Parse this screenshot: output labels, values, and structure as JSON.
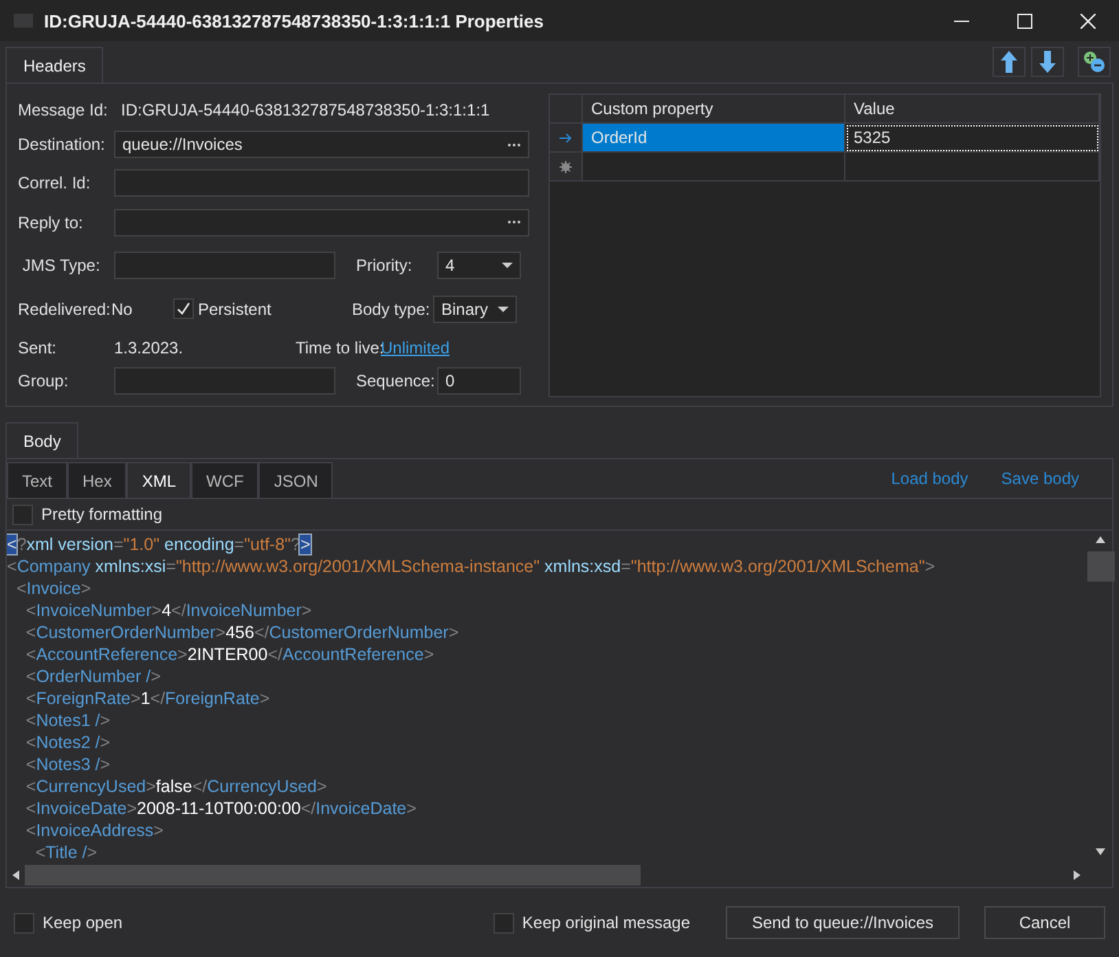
{
  "window": {
    "title": "ID:GRUJA-54440-638132787548738350-1:3:1:1:1 Properties"
  },
  "header_tab": {
    "label": "Headers",
    "selected": true
  },
  "headers": {
    "message_id": {
      "label": "Message Id:",
      "value": "ID:GRUJA-54440-638132787548738350-1:3:1:1:1"
    },
    "destination": {
      "label": "Destination:",
      "value": "queue://Invoices"
    },
    "correl_id": {
      "label": "Correl. Id:"
    },
    "reply_to": {
      "label": "Reply to:"
    },
    "jms_type": {
      "label": "JMS Type:"
    },
    "priority": {
      "label": "Priority:",
      "value": "4"
    },
    "redelivered": {
      "label": "Redelivered:",
      "value": "No"
    },
    "persistent": {
      "label": "Persistent",
      "checked": true
    },
    "body_type": {
      "label": "Body type:",
      "value": "Binary"
    },
    "sent": {
      "label": "Sent:",
      "value": "1.3.2023."
    },
    "time_to_live": {
      "label": "Time to live:",
      "value": "Unlimited"
    },
    "group": {
      "label": "Group:"
    },
    "sequence": {
      "label": "Sequence:",
      "value": "0"
    }
  },
  "properties": {
    "columns": [
      "Custom property",
      "Value"
    ],
    "rows": [
      {
        "name": "OrderId",
        "value": "5325",
        "selected": true
      }
    ]
  },
  "body_tab": {
    "label": "Body",
    "selected": true
  },
  "format_tabs": [
    {
      "label": "Text",
      "selected": false
    },
    {
      "label": "Hex",
      "selected": false
    },
    {
      "label": "XML",
      "selected": true
    },
    {
      "label": "WCF",
      "selected": false
    },
    {
      "label": "JSON",
      "selected": false
    }
  ],
  "body_links": [
    "Load body",
    "Save body"
  ],
  "pretty_formatting": {
    "label": "Pretty formatting",
    "checked": false
  },
  "xml_lines": [
    {
      "tokens": [
        {
          "kind": "match",
          "text": "<"
        },
        {
          "kind": "punct",
          "text": "?"
        },
        {
          "kind": "attr",
          "text": "xml version"
        },
        {
          "kind": "punct",
          "text": "="
        },
        {
          "kind": "value",
          "text": "\"1.0\""
        },
        {
          "kind": "attr",
          "text": " encoding"
        },
        {
          "kind": "punct",
          "text": "="
        },
        {
          "kind": "value",
          "text": "\"utf-8\""
        },
        {
          "kind": "punct",
          "text": "?"
        },
        {
          "kind": "match",
          "text": ">"
        }
      ]
    },
    {
      "tokens": [
        {
          "kind": "punct",
          "text": "<"
        },
        {
          "kind": "tag",
          "text": "Company"
        },
        {
          "kind": "attr",
          "text": " xmlns:xsi"
        },
        {
          "kind": "punct",
          "text": "="
        },
        {
          "kind": "value",
          "text": "\"http://www.w3.org/2001/XMLSchema-instance\""
        },
        {
          "kind": "attr",
          "text": " xmlns:xsd"
        },
        {
          "kind": "punct",
          "text": "="
        },
        {
          "kind": "value",
          "text": "\"http://www.w3.org/2001/XMLSchema\""
        },
        {
          "kind": "punct",
          "text": ">"
        }
      ]
    },
    {
      "tokens": [
        {
          "kind": "punct",
          "text": "  <"
        },
        {
          "kind": "tag",
          "text": "Invoice"
        },
        {
          "kind": "punct",
          "text": ">"
        }
      ]
    },
    {
      "tokens": [
        {
          "kind": "punct",
          "text": "    <"
        },
        {
          "kind": "tag",
          "text": "InvoiceNumber"
        },
        {
          "kind": "punct",
          "text": ">"
        },
        {
          "kind": "text",
          "text": "4"
        },
        {
          "kind": "punct",
          "text": "</"
        },
        {
          "kind": "tag",
          "text": "InvoiceNumber"
        },
        {
          "kind": "punct",
          "text": ">"
        }
      ]
    },
    {
      "tokens": [
        {
          "kind": "punct",
          "text": "    <"
        },
        {
          "kind": "tag",
          "text": "CustomerOrderNumber"
        },
        {
          "kind": "punct",
          "text": ">"
        },
        {
          "kind": "text",
          "text": "456"
        },
        {
          "kind": "punct",
          "text": "</"
        },
        {
          "kind": "tag",
          "text": "CustomerOrderNumber"
        },
        {
          "kind": "punct",
          "text": ">"
        }
      ]
    },
    {
      "tokens": [
        {
          "kind": "punct",
          "text": "    <"
        },
        {
          "kind": "tag",
          "text": "AccountReference"
        },
        {
          "kind": "punct",
          "text": ">"
        },
        {
          "kind": "text",
          "text": "2INTER00"
        },
        {
          "kind": "punct",
          "text": "</"
        },
        {
          "kind": "tag",
          "text": "AccountReference"
        },
        {
          "kind": "punct",
          "text": ">"
        }
      ]
    },
    {
      "tokens": [
        {
          "kind": "punct",
          "text": "    <"
        },
        {
          "kind": "tag",
          "text": "OrderNumber /"
        },
        {
          "kind": "punct",
          "text": ">"
        }
      ]
    },
    {
      "tokens": [
        {
          "kind": "punct",
          "text": "    <"
        },
        {
          "kind": "tag",
          "text": "ForeignRate"
        },
        {
          "kind": "punct",
          "text": ">"
        },
        {
          "kind": "text",
          "text": "1"
        },
        {
          "kind": "punct",
          "text": "</"
        },
        {
          "kind": "tag",
          "text": "ForeignRate"
        },
        {
          "kind": "punct",
          "text": ">"
        }
      ]
    },
    {
      "tokens": [
        {
          "kind": "punct",
          "text": "    <"
        },
        {
          "kind": "tag",
          "text": "Notes1 /"
        },
        {
          "kind": "punct",
          "text": ">"
        }
      ]
    },
    {
      "tokens": [
        {
          "kind": "punct",
          "text": "    <"
        },
        {
          "kind": "tag",
          "text": "Notes2 /"
        },
        {
          "kind": "punct",
          "text": ">"
        }
      ]
    },
    {
      "tokens": [
        {
          "kind": "punct",
          "text": "    <"
        },
        {
          "kind": "tag",
          "text": "Notes3 /"
        },
        {
          "kind": "punct",
          "text": ">"
        }
      ]
    },
    {
      "tokens": [
        {
          "kind": "punct",
          "text": "    <"
        },
        {
          "kind": "tag",
          "text": "CurrencyUsed"
        },
        {
          "kind": "punct",
          "text": ">"
        },
        {
          "kind": "text",
          "text": "false"
        },
        {
          "kind": "punct",
          "text": "</"
        },
        {
          "kind": "tag",
          "text": "CurrencyUsed"
        },
        {
          "kind": "punct",
          "text": ">"
        }
      ]
    },
    {
      "tokens": [
        {
          "kind": "punct",
          "text": "    <"
        },
        {
          "kind": "tag",
          "text": "InvoiceDate"
        },
        {
          "kind": "punct",
          "text": ">"
        },
        {
          "kind": "text",
          "text": "2008-11-10T00:00:00"
        },
        {
          "kind": "punct",
          "text": "</"
        },
        {
          "kind": "tag",
          "text": "InvoiceDate"
        },
        {
          "kind": "punct",
          "text": ">"
        }
      ]
    },
    {
      "tokens": [
        {
          "kind": "punct",
          "text": "    <"
        },
        {
          "kind": "tag",
          "text": "InvoiceAddress"
        },
        {
          "kind": "punct",
          "text": ">"
        }
      ]
    },
    {
      "tokens": [
        {
          "kind": "punct",
          "text": "      <"
        },
        {
          "kind": "tag",
          "text": "Title /"
        },
        {
          "kind": "punct",
          "text": ">"
        }
      ]
    }
  ],
  "footer": {
    "keep_open": {
      "label": "Keep open",
      "checked": false
    },
    "keep_original": {
      "label": "Keep original message",
      "checked": false
    },
    "buttons": [
      "Send to queue://Invoices",
      "Cancel"
    ]
  }
}
